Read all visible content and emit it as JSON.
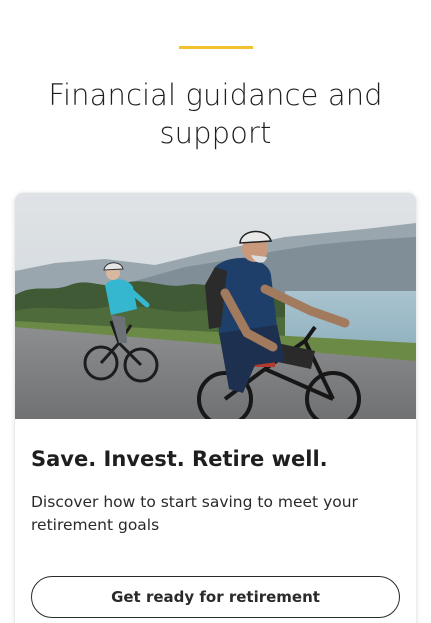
{
  "section": {
    "title": "Financial guidance and support"
  },
  "card": {
    "heading": "Save. Invest. Retire well.",
    "description": "Discover how to start saving to meet your retirement goals",
    "cta_label": "Get ready for retirement"
  },
  "colors": {
    "accent": "#f2c12e",
    "text": "#1e1e1e",
    "button_border": "#2b2b2b"
  }
}
